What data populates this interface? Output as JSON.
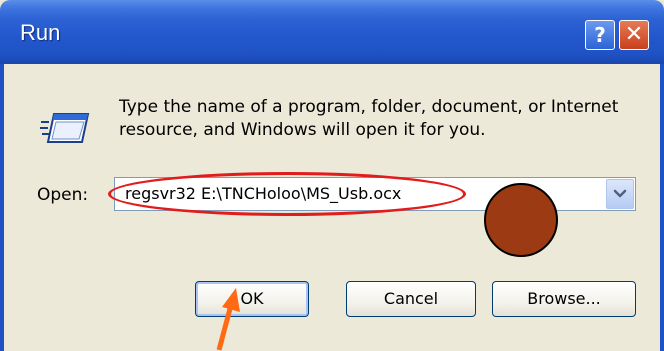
{
  "window": {
    "title": "Run"
  },
  "titlebar": {
    "help_label": "?",
    "close_label": "✕"
  },
  "dialog": {
    "prompt": "Type the name of a program, folder, document, or Internet resource, and Windows will open it for you.",
    "open_label": "Open:",
    "open_value": "regsvr32 E:\\TNCHoloo\\MS_Usb.ocx"
  },
  "buttons": {
    "ok": "OK",
    "cancel": "Cancel",
    "browse": "Browse..."
  },
  "icons": {
    "run": "run-window-icon",
    "dropdown": "chevron-down-icon",
    "help": "help-icon",
    "close": "close-icon"
  },
  "annotations": {
    "ellipse_color": "#e21b1b",
    "circle_color": "#9b3a13",
    "arrow_color": "#ff6a13"
  }
}
